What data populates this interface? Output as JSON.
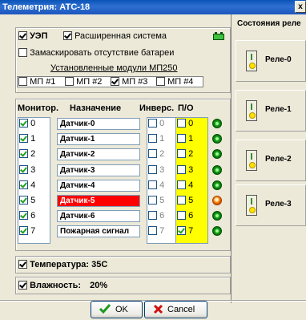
{
  "window": {
    "title": "Телеметрия: АТС-18",
    "close_label": "x"
  },
  "top_panel": {
    "uep_label": "УЭП",
    "extended_system_label": "Расширенная система",
    "mask_battery_label": "Замаскировать отсутствие батареи",
    "modules_link": "Установленные модули МП250",
    "modules": [
      {
        "label": "МП #1",
        "checked": false
      },
      {
        "label": "МП #2",
        "checked": false
      },
      {
        "label": "МП #3",
        "checked": true
      },
      {
        "label": "МП #4",
        "checked": false
      }
    ],
    "battery_icon": "battery-icon"
  },
  "sensors": {
    "headers": {
      "monitor": "Монитор.",
      "purpose": "Назначение",
      "invert": "Инверс.",
      "po": "П/О"
    },
    "rows": [
      {
        "index": "0",
        "monitor": true,
        "name": "Датчик-0",
        "invert": false,
        "po": false,
        "led": "ok"
      },
      {
        "index": "1",
        "monitor": true,
        "name": "Датчик-1",
        "invert": false,
        "po": false,
        "led": "ok"
      },
      {
        "index": "2",
        "monitor": true,
        "name": "Датчик-2",
        "invert": false,
        "po": false,
        "led": "ok"
      },
      {
        "index": "3",
        "monitor": true,
        "name": "Датчик-3",
        "invert": false,
        "po": false,
        "led": "ok"
      },
      {
        "index": "4",
        "monitor": true,
        "name": "Датчик-4",
        "invert": false,
        "po": false,
        "led": "ok"
      },
      {
        "index": "5",
        "monitor": true,
        "name": "Датчик-5",
        "invert": false,
        "po": false,
        "led": "alarm",
        "highlight": "#ff0000"
      },
      {
        "index": "6",
        "monitor": true,
        "name": "Датчик-6",
        "invert": false,
        "po": false,
        "led": "ok"
      },
      {
        "index": "7",
        "monitor": true,
        "name": "Пожарная сигнал",
        "invert": false,
        "po": true,
        "led": "ok"
      }
    ]
  },
  "temperature": {
    "label": "Температура:",
    "value": "35С"
  },
  "humidity": {
    "label": "Влажность:",
    "value": "20%"
  },
  "relays": {
    "header": "Состояния реле",
    "items": [
      {
        "label": "Реле-0"
      },
      {
        "label": "Реле-1"
      },
      {
        "label": "Реле-2"
      },
      {
        "label": "Реле-3"
      }
    ]
  },
  "buttons": {
    "ok": "OK",
    "cancel": "Cancel"
  },
  "colors": {
    "po_column": "#ffff00",
    "alarm_row": "#ff0000",
    "titlebar": "#0a54b8"
  }
}
